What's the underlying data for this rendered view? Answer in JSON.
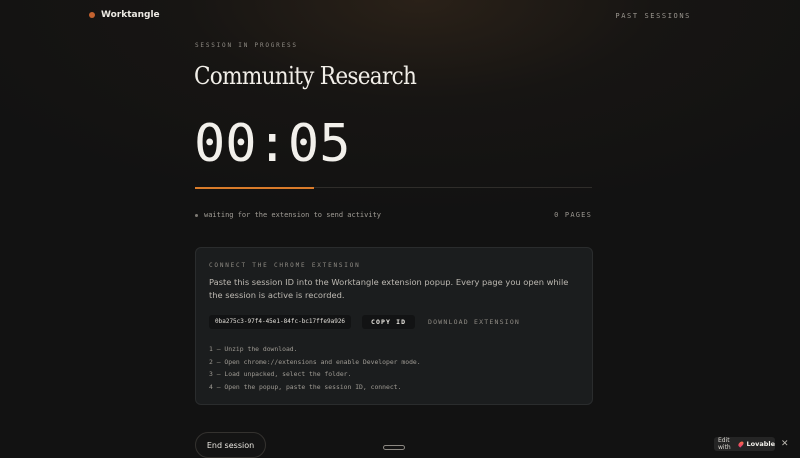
{
  "brand": {
    "name": "Worktangle",
    "accent": "#c4622f"
  },
  "nav": {
    "past_sessions": "PAST SESSIONS"
  },
  "session": {
    "eyebrow": "SESSION IN PROGRESS",
    "title": "Community Research",
    "timer": "00:05",
    "progress_fraction": 0.3,
    "progress_color": "#d97b2a",
    "status": "waiting for the extension to send activity",
    "pages": "0 PAGES"
  },
  "extension": {
    "title": "CONNECT THE CHROME EXTENSION",
    "description": "Paste this session ID into the Worktangle extension popup. Every page you open while the session is active is recorded.",
    "session_id": "0ba275c3-97f4-45e1-84fc-bc17ffe9a926",
    "copy_label": "COPY ID",
    "download_label": "DOWNLOAD EXTENSION",
    "steps": [
      "1 — Unzip the download.",
      "2 — Open chrome://extensions and enable Developer mode.",
      "3 — Load unpacked, select the folder.",
      "4 — Open the popup, paste the session ID, connect."
    ]
  },
  "actions": {
    "end_session": "End session"
  },
  "badge": {
    "edit": "Edit with",
    "name": "Lovable",
    "close": "✕"
  }
}
